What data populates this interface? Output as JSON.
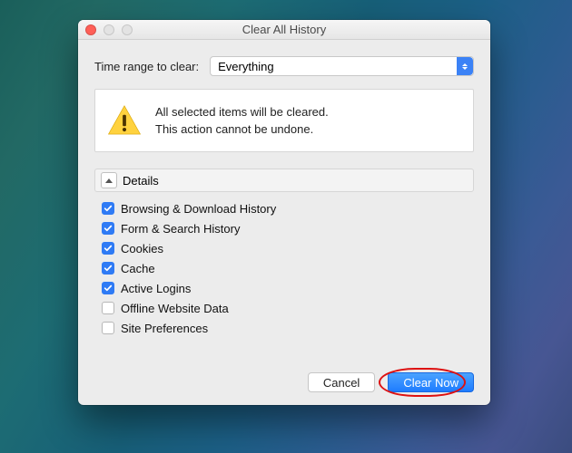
{
  "window": {
    "title": "Clear All History"
  },
  "range": {
    "label": "Time range to clear:",
    "selected": "Everything"
  },
  "warning": {
    "line1": "All selected items will be cleared.",
    "line2": "This action cannot be undone."
  },
  "details": {
    "label": "Details"
  },
  "items": [
    {
      "label": "Browsing & Download History",
      "checked": true
    },
    {
      "label": "Form & Search History",
      "checked": true
    },
    {
      "label": "Cookies",
      "checked": true
    },
    {
      "label": "Cache",
      "checked": true
    },
    {
      "label": "Active Logins",
      "checked": true
    },
    {
      "label": "Offline Website Data",
      "checked": false
    },
    {
      "label": "Site Preferences",
      "checked": false
    }
  ],
  "buttons": {
    "cancel": "Cancel",
    "clear": "Clear Now"
  }
}
